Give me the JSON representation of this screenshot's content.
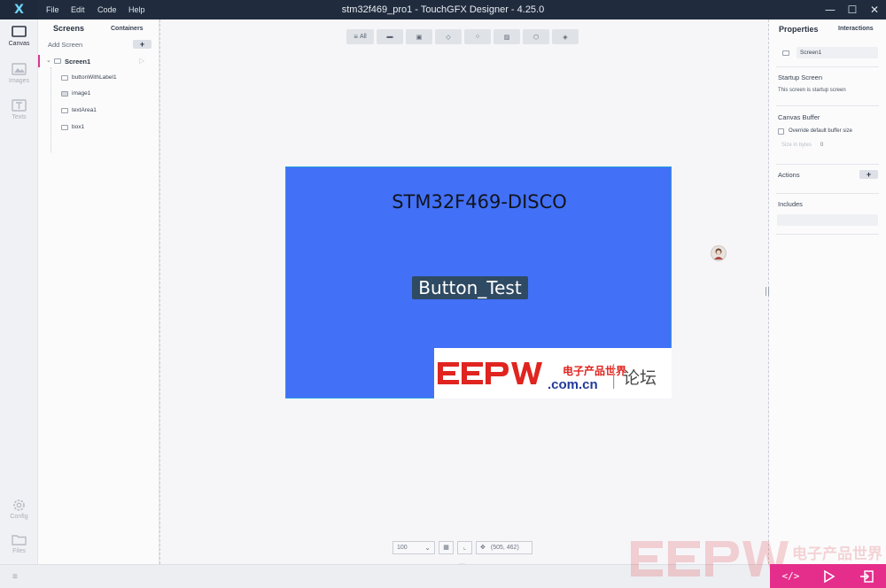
{
  "window": {
    "title": "stm32f469_pro1 - TouchGFX Designer - 4.25.0",
    "logo": "X"
  },
  "menu": [
    {
      "label": "File"
    },
    {
      "label": "Edit"
    },
    {
      "label": "Code"
    },
    {
      "label": "Help"
    }
  ],
  "rail": [
    {
      "label": "Canvas",
      "icon": "canvas-icon"
    },
    {
      "label": "Images",
      "icon": "images-icon"
    },
    {
      "label": "Texts",
      "icon": "texts-icon"
    },
    {
      "label": "Config",
      "icon": "gear-icon"
    },
    {
      "label": "Files",
      "icon": "folder-icon"
    }
  ],
  "screens_panel": {
    "tab_screens": "Screens",
    "tab_containers": "Containers",
    "add_screen": "Add Screen",
    "add_button": "+",
    "screen": {
      "name": "Screen1"
    },
    "widgets": [
      {
        "name": "buttonWithLabel1"
      },
      {
        "name": "image1"
      },
      {
        "name": "textArea1"
      },
      {
        "name": "box1"
      }
    ]
  },
  "canvas_toolbar": {
    "all_label": "All"
  },
  "canvas": {
    "background_color": "#4270F7",
    "text_area": "STM32F469-DISCO",
    "button_label": "Button_Test",
    "image_logo": {
      "brand": "EEPW",
      "chinese": "电子产品世界",
      "domain": ".com.cn",
      "forum": "论坛"
    }
  },
  "canvas_bottom": {
    "zoom": "100",
    "coords": "(505, 462)"
  },
  "properties": {
    "tab_properties": "Properties",
    "tab_interactions": "Interactions",
    "name_value": "Screen1",
    "startup_heading": "Startup Screen",
    "startup_text": "This screen is startup screen",
    "canvas_buffer_heading": "Canvas Buffer",
    "override_label": "Override default buffer size",
    "size_label": "Size in bytes",
    "size_value": "0",
    "actions_heading": "Actions",
    "actions_add": "+",
    "includes_heading": "Includes"
  },
  "colors": {
    "accent": "#E52E8C",
    "titlebar": "#202C3E",
    "canvas_blue": "#4270F7"
  }
}
